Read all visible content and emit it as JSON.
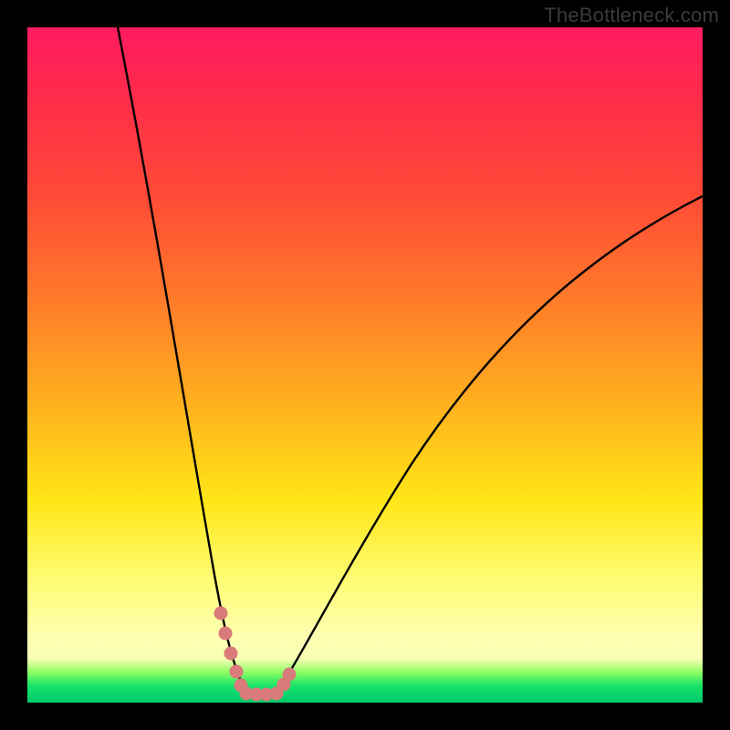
{
  "watermark": "TheBottleneck.com",
  "colors": {
    "background": "#000000",
    "curve_stroke": "#000000",
    "marker_fill": "#d97b7a",
    "gradient_stops": [
      "#ff1b61",
      "#ff2b4a",
      "#ff4a37",
      "#ff7a2a",
      "#ffae1f",
      "#ffe617",
      "#fffd74",
      "#ffffb0",
      "#f7ffb5",
      "#8dff63",
      "#17e36a",
      "#00c96e"
    ]
  },
  "chart_data": {
    "type": "line",
    "title": "",
    "xlabel": "",
    "ylabel": "",
    "xlim": [
      0,
      100
    ],
    "ylim": [
      0,
      100
    ],
    "note": "Axes unlabeled; values approximated from curve shape on a 0–100 normalized grid. Minimum (~0) occurs around x≈32–36. Left branch rises steeply toward 100 near x≈13; right branch rises more gradually, reaching ~75 at x=100.",
    "series": [
      {
        "name": "bottleneck-curve",
        "x": [
          13,
          16,
          20,
          24,
          28,
          30,
          32,
          34,
          36,
          38,
          42,
          48,
          56,
          64,
          72,
          80,
          88,
          96,
          100
        ],
        "y": [
          100,
          80,
          55,
          34,
          16,
          9,
          3,
          0,
          0,
          3,
          9,
          18,
          30,
          41,
          50,
          58,
          65,
          72,
          75
        ]
      }
    ],
    "markers": {
      "name": "highlighted-points",
      "style": "thick-salmon-dots",
      "x": [
        28.5,
        29.5,
        30.5,
        31,
        32,
        33,
        34,
        35,
        36,
        37,
        37.5
      ],
      "y": [
        12,
        8,
        5,
        2,
        0.5,
        0,
        0,
        0,
        0.5,
        2,
        4
      ]
    }
  }
}
